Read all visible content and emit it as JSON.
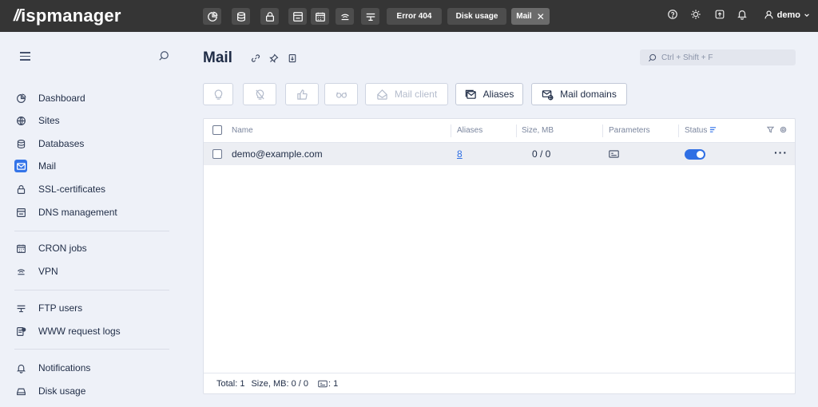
{
  "app": {
    "logo_mark": "//",
    "logo_text": "ispmanager",
    "user": "demo"
  },
  "topbar": {
    "quick_icons": [
      "dashboard-icon",
      "database-icon",
      "ssl-lock-icon",
      "dns-icon",
      "cron-icon",
      "vpn-icon",
      "ftp-icon"
    ],
    "tabs": [
      {
        "label": "Error 404",
        "active": false
      },
      {
        "label": "Disk usage",
        "active": false
      },
      {
        "label": "Mail",
        "active": true,
        "close": "✕"
      }
    ],
    "right_icons": [
      "help-icon",
      "theme-icon",
      "export-icon",
      "bell-icon"
    ]
  },
  "sidebar": {
    "items": [
      {
        "label": "Dashboard",
        "icon": "dashboard-icon"
      },
      {
        "label": "Sites",
        "icon": "globe-icon"
      },
      {
        "label": "Databases",
        "icon": "database-icon"
      },
      {
        "label": "Mail",
        "icon": "mail-icon",
        "active": true
      },
      {
        "label": "SSL-certificates",
        "icon": "ssl-lock-icon"
      },
      {
        "label": "DNS management",
        "icon": "dns-icon"
      },
      {
        "label": "CRON jobs",
        "icon": "cron-icon"
      },
      {
        "label": "VPN",
        "icon": "vpn-icon"
      },
      {
        "label": "FTP users",
        "icon": "ftp-icon"
      },
      {
        "label": "WWW request logs",
        "icon": "logs-icon"
      },
      {
        "label": "Notifications",
        "icon": "bell-icon"
      },
      {
        "label": "Disk usage",
        "icon": "disk-icon"
      }
    ]
  },
  "main": {
    "title": "Mail",
    "search_placeholder": "Ctrl + Shift + F",
    "toolbar": {
      "mail_client": "Mail client",
      "aliases": "Aliases",
      "mail_domains": "Mail domains"
    },
    "table": {
      "columns": {
        "name": "Name",
        "aliases": "Aliases",
        "size": "Size, MB",
        "parameters": "Parameters",
        "status": "Status"
      },
      "rows": [
        {
          "name": "demo@example.com",
          "aliases": "8",
          "size": "0 / 0",
          "status": "on"
        }
      ],
      "footer": {
        "total": "Total: 1",
        "size": "Size, MB: 0 / 0",
        "params": ": 1"
      }
    }
  },
  "colors": {
    "accent": "#2f6fe4",
    "topbar": "#353535",
    "background": "#eef1f8"
  }
}
